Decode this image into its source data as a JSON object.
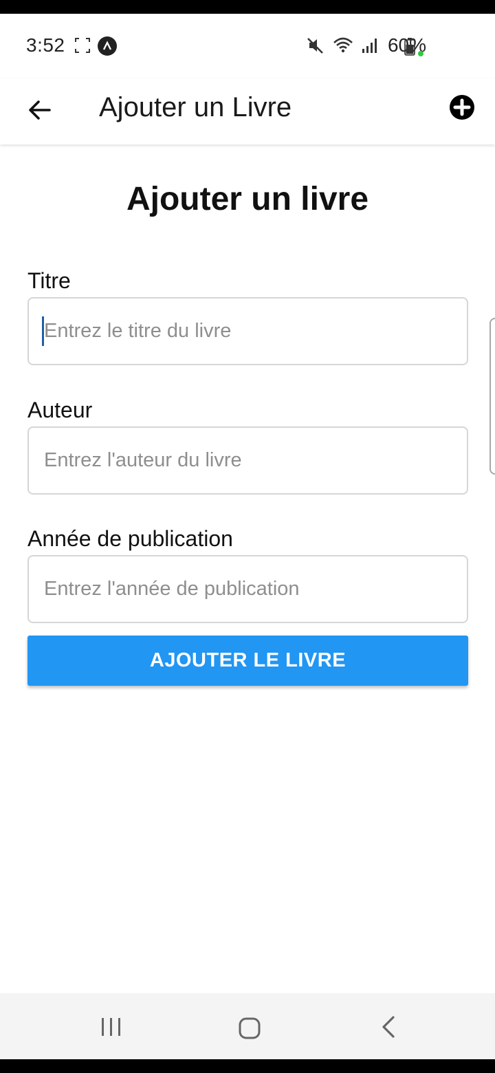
{
  "status_bar": {
    "time": "3:52",
    "battery": "60%",
    "icons": [
      "screenshot-icon",
      "app-icon",
      "mute-icon",
      "wifi-icon",
      "signal-icon",
      "battery-icon"
    ]
  },
  "header": {
    "title": "Ajouter un Livre",
    "back_icon": "arrow-left-icon",
    "add_icon": "plus-circle-icon"
  },
  "form": {
    "title": "Ajouter un livre",
    "fields": [
      {
        "label": "Titre",
        "placeholder": "Entrez le titre du livre",
        "value": ""
      },
      {
        "label": "Auteur",
        "placeholder": "Entrez l'auteur du livre",
        "value": ""
      },
      {
        "label": "Année de publication",
        "placeholder": "Entrez l'année de publication",
        "value": ""
      }
    ],
    "submit_label": "AJOUTER LE LIVRE"
  },
  "nav_bar": {
    "icons": [
      "recents-icon",
      "home-icon",
      "back-icon"
    ]
  },
  "colors": {
    "accent": "#2196f3",
    "text": "#111111",
    "placeholder": "#8e8e8e",
    "input_border": "#d6d6d6"
  }
}
